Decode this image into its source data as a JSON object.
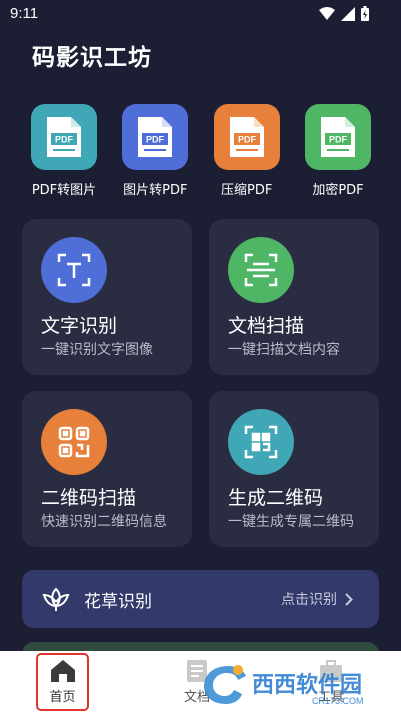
{
  "status": {
    "time": "9:11"
  },
  "app": {
    "title": "码影识工坊"
  },
  "tools": [
    {
      "label": "PDF转图片",
      "color": "#3fa7b6",
      "icon": "pdf-file-icon"
    },
    {
      "label": "图片转PDF",
      "color": "#4f6ed8",
      "icon": "pdf-file-icon"
    },
    {
      "label": "压缩PDF",
      "color": "#e7803a",
      "icon": "pdf-file-icon"
    },
    {
      "label": "加密PDF",
      "color": "#4fb666",
      "icon": "pdf-file-icon"
    }
  ],
  "cards": [
    {
      "title": "文字识别",
      "subtitle": "一键识别文字图像",
      "color": "#4f6ed8",
      "icon": "text-scan-icon"
    },
    {
      "title": "文档扫描",
      "subtitle": "一键扫描文档内容",
      "color": "#4fb666",
      "icon": "document-scan-icon"
    },
    {
      "title": "二维码扫描",
      "subtitle": "快速识别二维码信息",
      "color": "#e7803a",
      "icon": "qr-code-icon"
    },
    {
      "title": "生成二维码",
      "subtitle": "一键生成专属二维码",
      "color": "#3fa7b6",
      "icon": "qr-generate-icon"
    }
  ],
  "banner": {
    "title": "花草识别",
    "action": "点击识别",
    "icon": "flower-icon"
  },
  "nav": {
    "home": "首页",
    "docs": "文档",
    "tools": "工具"
  },
  "watermark": {
    "text": "西西软件园",
    "url": "CR173.COM"
  }
}
